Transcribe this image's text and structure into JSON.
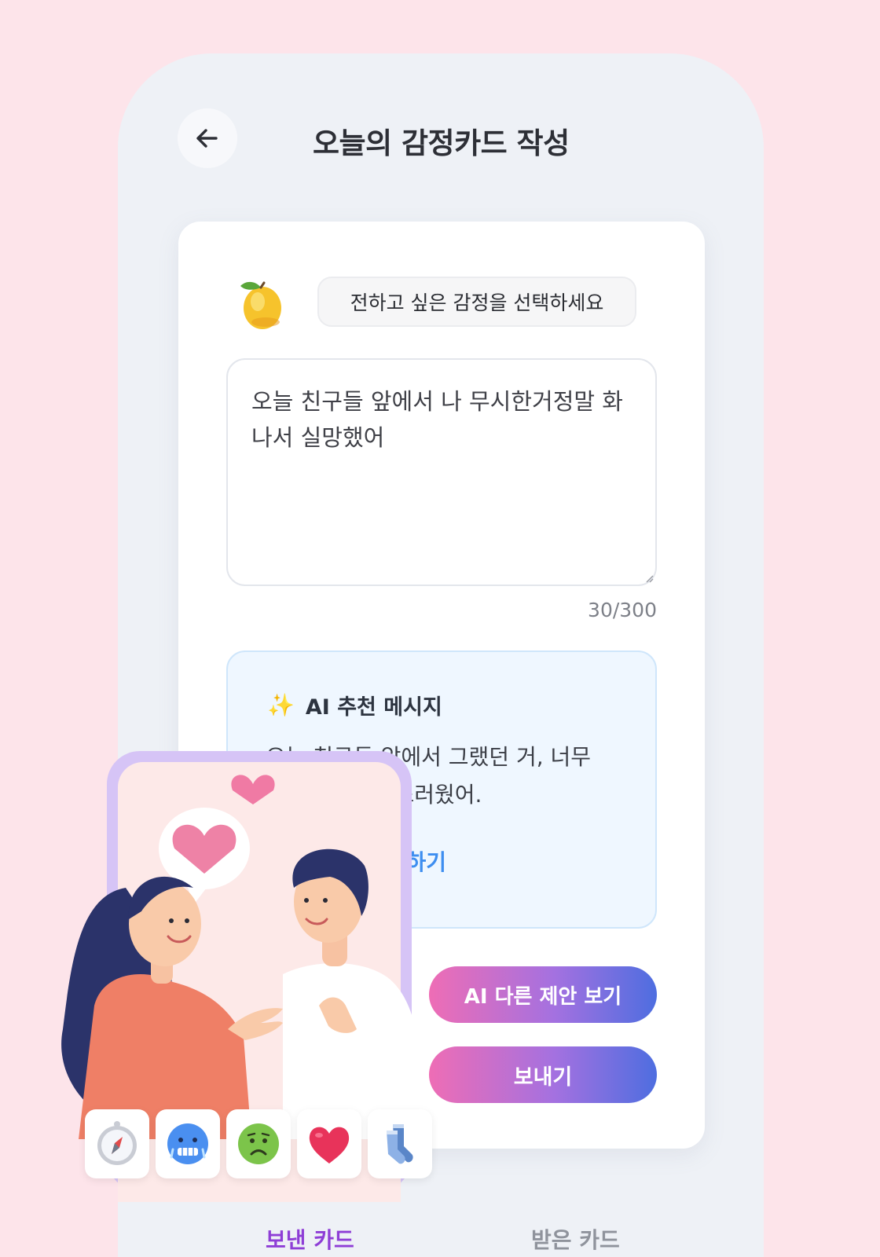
{
  "header": {
    "title": "오늘의 감정카드 작성"
  },
  "card": {
    "emotion_prompt": "전하고 싶은 감정을 선택하세요",
    "message_text": "오늘 친구들 앞에서 나 무시한거정말 화나서 실망했어",
    "char_count": "30/300",
    "ai_box": {
      "title": "AI 추천 메시지",
      "message_line_1": "오늘 친구들 앞에서 그랬던 거, 너무",
      "message_line_2": "속상하고 실망스러웠어.",
      "apply_link": "적용하기"
    },
    "suggest_button": "AI 다른 제안 보기",
    "send_button": "보내기"
  },
  "emoji_tray": [
    "compass-emoji",
    "cold-face-emoji",
    "nauseated-face-emoji",
    "red-heart-emoji",
    "socks-emoji"
  ],
  "tabs": {
    "sent": "보낸 카드",
    "received": "받은 카드"
  },
  "colors": {
    "page_background": "#fde4ea",
    "phone_background": "#eef1f6",
    "active_tab": "#8e3ed6",
    "link": "#3e8ef0",
    "gradient_start": "#ee6db5",
    "gradient_end": "#4e6ee0"
  }
}
